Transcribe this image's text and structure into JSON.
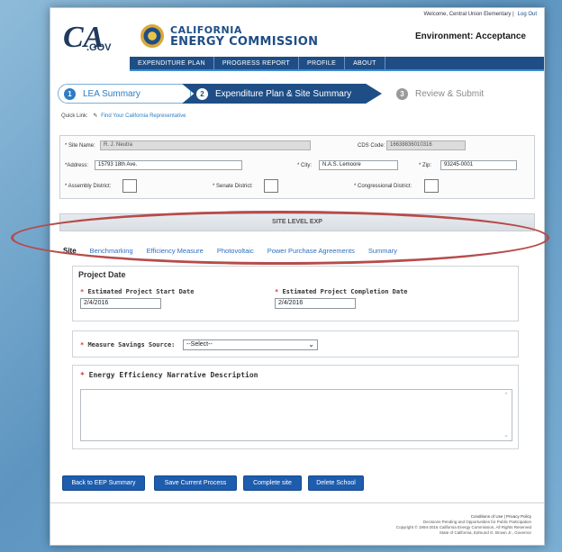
{
  "header": {
    "welcome": "Welcome, Central Union Elementary |",
    "logout": "Log Out",
    "logo_text_main": "CA",
    "logo_text_sub": ".GOV",
    "commission_line1": "CALIFORNIA",
    "commission_line2": "ENERGY COMMISSION",
    "environment": "Environment: Acceptance"
  },
  "nav": {
    "items": [
      "EXPENDITURE PLAN",
      "PROGRESS REPORT",
      "PROFILE",
      "ABOUT"
    ]
  },
  "steps": [
    {
      "num": "1",
      "label": "LEA Summary"
    },
    {
      "num": "2",
      "label": "Expenditure Plan & Site Summary"
    },
    {
      "num": "3",
      "label": "Review & Submit"
    }
  ],
  "quicklink": {
    "label": "Quick Link:",
    "link": "Find Your California Representative"
  },
  "site_info": {
    "site_name_label": "* Site Name:",
    "site_name": "R. J. Neutra",
    "cds_label": "CDS Code:",
    "cds_code": "16638836010316",
    "address_label": "*Address:",
    "address": "15793 18th Ave.",
    "city_label": "* City:",
    "city": "N.A.S. Lemoore",
    "zip_label": "* Zip:",
    "zip": "93245-0001",
    "assembly_label": "* Assembly District:",
    "senate_label": "* Senate District:",
    "congressional_label": "* Congressional District:"
  },
  "site_level_title": "SITE LEVEL EXP",
  "tabs": [
    "Site",
    "Benchmarking",
    "Efficiency Measure",
    "Photovoltaic",
    "Power Purchase Agreements",
    "Summary"
  ],
  "project_date": {
    "title": "Project Date",
    "start_label": "Estimated Project Start Date",
    "start_value": "2/4/2016",
    "completion_label": "Estimated Project Completion Date",
    "completion_value": "2/4/2016"
  },
  "measure": {
    "label": "Measure Savings Source:",
    "selected": "--Select--"
  },
  "narrative": {
    "title": "Energy Efficiency Narrative Description"
  },
  "buttons": {
    "back": "Back to EEP Summary",
    "save": "Save Current Process",
    "complete": "Complete site",
    "delete": "Delete School"
  },
  "footer": {
    "links": "Conditions of Use  |  Privacy Policy",
    "line2": "Decisions Pending and Opportunities for Public Participation",
    "line3": "Copyright © 1994-2016 California Energy Commission, All Rights Reserved",
    "line4": "State of California, Edmund G. Brown Jr., Governor"
  }
}
